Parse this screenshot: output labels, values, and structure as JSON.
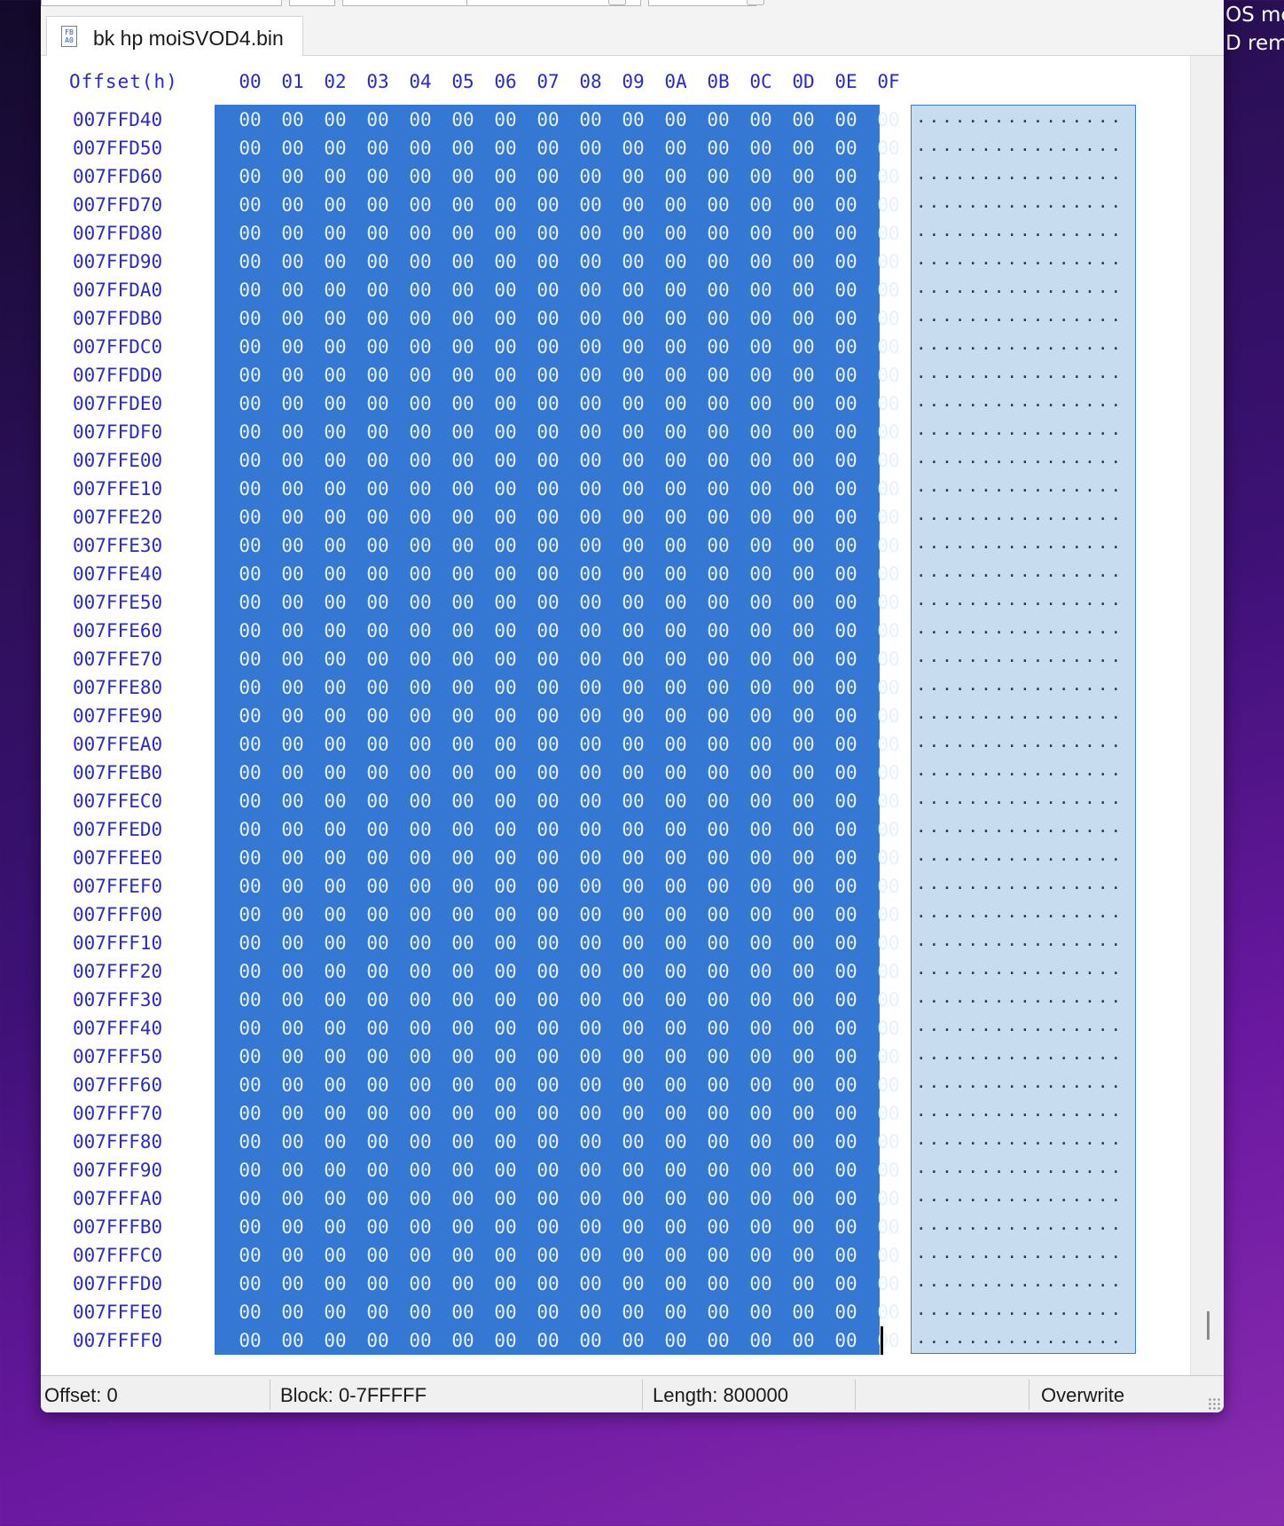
{
  "desktop": {
    "overlay_text_1": "OS mer",
    "overlay_text_2": "D remo"
  },
  "tab": {
    "label": "bk hp moiSVOD4.bin",
    "icon": "binary-file-icon",
    "icon_glyph": "FB\nA0"
  },
  "header": {
    "offset_label": "Offset(h)",
    "columns": [
      "00",
      "01",
      "02",
      "03",
      "04",
      "05",
      "06",
      "07",
      "08",
      "09",
      "0A",
      "0B",
      "0C",
      "0D",
      "0E",
      "0F"
    ]
  },
  "rows": [
    {
      "offset": "007FFD40",
      "bytes": [
        "00",
        "00",
        "00",
        "00",
        "00",
        "00",
        "00",
        "00",
        "00",
        "00",
        "00",
        "00",
        "00",
        "00",
        "00",
        "00"
      ],
      "ascii": "................"
    },
    {
      "offset": "007FFD50",
      "bytes": [
        "00",
        "00",
        "00",
        "00",
        "00",
        "00",
        "00",
        "00",
        "00",
        "00",
        "00",
        "00",
        "00",
        "00",
        "00",
        "00"
      ],
      "ascii": "................"
    },
    {
      "offset": "007FFD60",
      "bytes": [
        "00",
        "00",
        "00",
        "00",
        "00",
        "00",
        "00",
        "00",
        "00",
        "00",
        "00",
        "00",
        "00",
        "00",
        "00",
        "00"
      ],
      "ascii": "................"
    },
    {
      "offset": "007FFD70",
      "bytes": [
        "00",
        "00",
        "00",
        "00",
        "00",
        "00",
        "00",
        "00",
        "00",
        "00",
        "00",
        "00",
        "00",
        "00",
        "00",
        "00"
      ],
      "ascii": "................"
    },
    {
      "offset": "007FFD80",
      "bytes": [
        "00",
        "00",
        "00",
        "00",
        "00",
        "00",
        "00",
        "00",
        "00",
        "00",
        "00",
        "00",
        "00",
        "00",
        "00",
        "00"
      ],
      "ascii": "................"
    },
    {
      "offset": "007FFD90",
      "bytes": [
        "00",
        "00",
        "00",
        "00",
        "00",
        "00",
        "00",
        "00",
        "00",
        "00",
        "00",
        "00",
        "00",
        "00",
        "00",
        "00"
      ],
      "ascii": "................"
    },
    {
      "offset": "007FFDA0",
      "bytes": [
        "00",
        "00",
        "00",
        "00",
        "00",
        "00",
        "00",
        "00",
        "00",
        "00",
        "00",
        "00",
        "00",
        "00",
        "00",
        "00"
      ],
      "ascii": "................"
    },
    {
      "offset": "007FFDB0",
      "bytes": [
        "00",
        "00",
        "00",
        "00",
        "00",
        "00",
        "00",
        "00",
        "00",
        "00",
        "00",
        "00",
        "00",
        "00",
        "00",
        "00"
      ],
      "ascii": "................"
    },
    {
      "offset": "007FFDC0",
      "bytes": [
        "00",
        "00",
        "00",
        "00",
        "00",
        "00",
        "00",
        "00",
        "00",
        "00",
        "00",
        "00",
        "00",
        "00",
        "00",
        "00"
      ],
      "ascii": "................"
    },
    {
      "offset": "007FFDD0",
      "bytes": [
        "00",
        "00",
        "00",
        "00",
        "00",
        "00",
        "00",
        "00",
        "00",
        "00",
        "00",
        "00",
        "00",
        "00",
        "00",
        "00"
      ],
      "ascii": "................"
    },
    {
      "offset": "007FFDE0",
      "bytes": [
        "00",
        "00",
        "00",
        "00",
        "00",
        "00",
        "00",
        "00",
        "00",
        "00",
        "00",
        "00",
        "00",
        "00",
        "00",
        "00"
      ],
      "ascii": "................"
    },
    {
      "offset": "007FFDF0",
      "bytes": [
        "00",
        "00",
        "00",
        "00",
        "00",
        "00",
        "00",
        "00",
        "00",
        "00",
        "00",
        "00",
        "00",
        "00",
        "00",
        "00"
      ],
      "ascii": "................"
    },
    {
      "offset": "007FFE00",
      "bytes": [
        "00",
        "00",
        "00",
        "00",
        "00",
        "00",
        "00",
        "00",
        "00",
        "00",
        "00",
        "00",
        "00",
        "00",
        "00",
        "00"
      ],
      "ascii": "................"
    },
    {
      "offset": "007FFE10",
      "bytes": [
        "00",
        "00",
        "00",
        "00",
        "00",
        "00",
        "00",
        "00",
        "00",
        "00",
        "00",
        "00",
        "00",
        "00",
        "00",
        "00"
      ],
      "ascii": "................"
    },
    {
      "offset": "007FFE20",
      "bytes": [
        "00",
        "00",
        "00",
        "00",
        "00",
        "00",
        "00",
        "00",
        "00",
        "00",
        "00",
        "00",
        "00",
        "00",
        "00",
        "00"
      ],
      "ascii": "................"
    },
    {
      "offset": "007FFE30",
      "bytes": [
        "00",
        "00",
        "00",
        "00",
        "00",
        "00",
        "00",
        "00",
        "00",
        "00",
        "00",
        "00",
        "00",
        "00",
        "00",
        "00"
      ],
      "ascii": "................"
    },
    {
      "offset": "007FFE40",
      "bytes": [
        "00",
        "00",
        "00",
        "00",
        "00",
        "00",
        "00",
        "00",
        "00",
        "00",
        "00",
        "00",
        "00",
        "00",
        "00",
        "00"
      ],
      "ascii": "................"
    },
    {
      "offset": "007FFE50",
      "bytes": [
        "00",
        "00",
        "00",
        "00",
        "00",
        "00",
        "00",
        "00",
        "00",
        "00",
        "00",
        "00",
        "00",
        "00",
        "00",
        "00"
      ],
      "ascii": "................"
    },
    {
      "offset": "007FFE60",
      "bytes": [
        "00",
        "00",
        "00",
        "00",
        "00",
        "00",
        "00",
        "00",
        "00",
        "00",
        "00",
        "00",
        "00",
        "00",
        "00",
        "00"
      ],
      "ascii": "................"
    },
    {
      "offset": "007FFE70",
      "bytes": [
        "00",
        "00",
        "00",
        "00",
        "00",
        "00",
        "00",
        "00",
        "00",
        "00",
        "00",
        "00",
        "00",
        "00",
        "00",
        "00"
      ],
      "ascii": "................"
    },
    {
      "offset": "007FFE80",
      "bytes": [
        "00",
        "00",
        "00",
        "00",
        "00",
        "00",
        "00",
        "00",
        "00",
        "00",
        "00",
        "00",
        "00",
        "00",
        "00",
        "00"
      ],
      "ascii": "................"
    },
    {
      "offset": "007FFE90",
      "bytes": [
        "00",
        "00",
        "00",
        "00",
        "00",
        "00",
        "00",
        "00",
        "00",
        "00",
        "00",
        "00",
        "00",
        "00",
        "00",
        "00"
      ],
      "ascii": "................"
    },
    {
      "offset": "007FFEA0",
      "bytes": [
        "00",
        "00",
        "00",
        "00",
        "00",
        "00",
        "00",
        "00",
        "00",
        "00",
        "00",
        "00",
        "00",
        "00",
        "00",
        "00"
      ],
      "ascii": "................"
    },
    {
      "offset": "007FFEB0",
      "bytes": [
        "00",
        "00",
        "00",
        "00",
        "00",
        "00",
        "00",
        "00",
        "00",
        "00",
        "00",
        "00",
        "00",
        "00",
        "00",
        "00"
      ],
      "ascii": "................"
    },
    {
      "offset": "007FFEC0",
      "bytes": [
        "00",
        "00",
        "00",
        "00",
        "00",
        "00",
        "00",
        "00",
        "00",
        "00",
        "00",
        "00",
        "00",
        "00",
        "00",
        "00"
      ],
      "ascii": "................"
    },
    {
      "offset": "007FFED0",
      "bytes": [
        "00",
        "00",
        "00",
        "00",
        "00",
        "00",
        "00",
        "00",
        "00",
        "00",
        "00",
        "00",
        "00",
        "00",
        "00",
        "00"
      ],
      "ascii": "................"
    },
    {
      "offset": "007FFEE0",
      "bytes": [
        "00",
        "00",
        "00",
        "00",
        "00",
        "00",
        "00",
        "00",
        "00",
        "00",
        "00",
        "00",
        "00",
        "00",
        "00",
        "00"
      ],
      "ascii": "................"
    },
    {
      "offset": "007FFEF0",
      "bytes": [
        "00",
        "00",
        "00",
        "00",
        "00",
        "00",
        "00",
        "00",
        "00",
        "00",
        "00",
        "00",
        "00",
        "00",
        "00",
        "00"
      ],
      "ascii": "................"
    },
    {
      "offset": "007FFF00",
      "bytes": [
        "00",
        "00",
        "00",
        "00",
        "00",
        "00",
        "00",
        "00",
        "00",
        "00",
        "00",
        "00",
        "00",
        "00",
        "00",
        "00"
      ],
      "ascii": "................"
    },
    {
      "offset": "007FFF10",
      "bytes": [
        "00",
        "00",
        "00",
        "00",
        "00",
        "00",
        "00",
        "00",
        "00",
        "00",
        "00",
        "00",
        "00",
        "00",
        "00",
        "00"
      ],
      "ascii": "................"
    },
    {
      "offset": "007FFF20",
      "bytes": [
        "00",
        "00",
        "00",
        "00",
        "00",
        "00",
        "00",
        "00",
        "00",
        "00",
        "00",
        "00",
        "00",
        "00",
        "00",
        "00"
      ],
      "ascii": "................"
    },
    {
      "offset": "007FFF30",
      "bytes": [
        "00",
        "00",
        "00",
        "00",
        "00",
        "00",
        "00",
        "00",
        "00",
        "00",
        "00",
        "00",
        "00",
        "00",
        "00",
        "00"
      ],
      "ascii": "................"
    },
    {
      "offset": "007FFF40",
      "bytes": [
        "00",
        "00",
        "00",
        "00",
        "00",
        "00",
        "00",
        "00",
        "00",
        "00",
        "00",
        "00",
        "00",
        "00",
        "00",
        "00"
      ],
      "ascii": "................"
    },
    {
      "offset": "007FFF50",
      "bytes": [
        "00",
        "00",
        "00",
        "00",
        "00",
        "00",
        "00",
        "00",
        "00",
        "00",
        "00",
        "00",
        "00",
        "00",
        "00",
        "00"
      ],
      "ascii": "................"
    },
    {
      "offset": "007FFF60",
      "bytes": [
        "00",
        "00",
        "00",
        "00",
        "00",
        "00",
        "00",
        "00",
        "00",
        "00",
        "00",
        "00",
        "00",
        "00",
        "00",
        "00"
      ],
      "ascii": "................"
    },
    {
      "offset": "007FFF70",
      "bytes": [
        "00",
        "00",
        "00",
        "00",
        "00",
        "00",
        "00",
        "00",
        "00",
        "00",
        "00",
        "00",
        "00",
        "00",
        "00",
        "00"
      ],
      "ascii": "................"
    },
    {
      "offset": "007FFF80",
      "bytes": [
        "00",
        "00",
        "00",
        "00",
        "00",
        "00",
        "00",
        "00",
        "00",
        "00",
        "00",
        "00",
        "00",
        "00",
        "00",
        "00"
      ],
      "ascii": "................"
    },
    {
      "offset": "007FFF90",
      "bytes": [
        "00",
        "00",
        "00",
        "00",
        "00",
        "00",
        "00",
        "00",
        "00",
        "00",
        "00",
        "00",
        "00",
        "00",
        "00",
        "00"
      ],
      "ascii": "................"
    },
    {
      "offset": "007FFFA0",
      "bytes": [
        "00",
        "00",
        "00",
        "00",
        "00",
        "00",
        "00",
        "00",
        "00",
        "00",
        "00",
        "00",
        "00",
        "00",
        "00",
        "00"
      ],
      "ascii": "................"
    },
    {
      "offset": "007FFFB0",
      "bytes": [
        "00",
        "00",
        "00",
        "00",
        "00",
        "00",
        "00",
        "00",
        "00",
        "00",
        "00",
        "00",
        "00",
        "00",
        "00",
        "00"
      ],
      "ascii": "................"
    },
    {
      "offset": "007FFFC0",
      "bytes": [
        "00",
        "00",
        "00",
        "00",
        "00",
        "00",
        "00",
        "00",
        "00",
        "00",
        "00",
        "00",
        "00",
        "00",
        "00",
        "00"
      ],
      "ascii": "................"
    },
    {
      "offset": "007FFFD0",
      "bytes": [
        "00",
        "00",
        "00",
        "00",
        "00",
        "00",
        "00",
        "00",
        "00",
        "00",
        "00",
        "00",
        "00",
        "00",
        "00",
        "00"
      ],
      "ascii": "................"
    },
    {
      "offset": "007FFFE0",
      "bytes": [
        "00",
        "00",
        "00",
        "00",
        "00",
        "00",
        "00",
        "00",
        "00",
        "00",
        "00",
        "00",
        "00",
        "00",
        "00",
        "00"
      ],
      "ascii": "................"
    },
    {
      "offset": "007FFFF0",
      "bytes": [
        "00",
        "00",
        "00",
        "00",
        "00",
        "00",
        "00",
        "00",
        "00",
        "00",
        "00",
        "00",
        "00",
        "00",
        "00",
        "00"
      ],
      "ascii": "................"
    }
  ],
  "status": {
    "offset": "Offset: 0",
    "block": "Block: 0-7FFFFF",
    "length": "Length: 800000",
    "mode": "Overwrite"
  },
  "colors": {
    "hex_text": "#2a2acc",
    "selection_hex": "#3478d4",
    "selection_ascii": "#c8dcf0"
  }
}
